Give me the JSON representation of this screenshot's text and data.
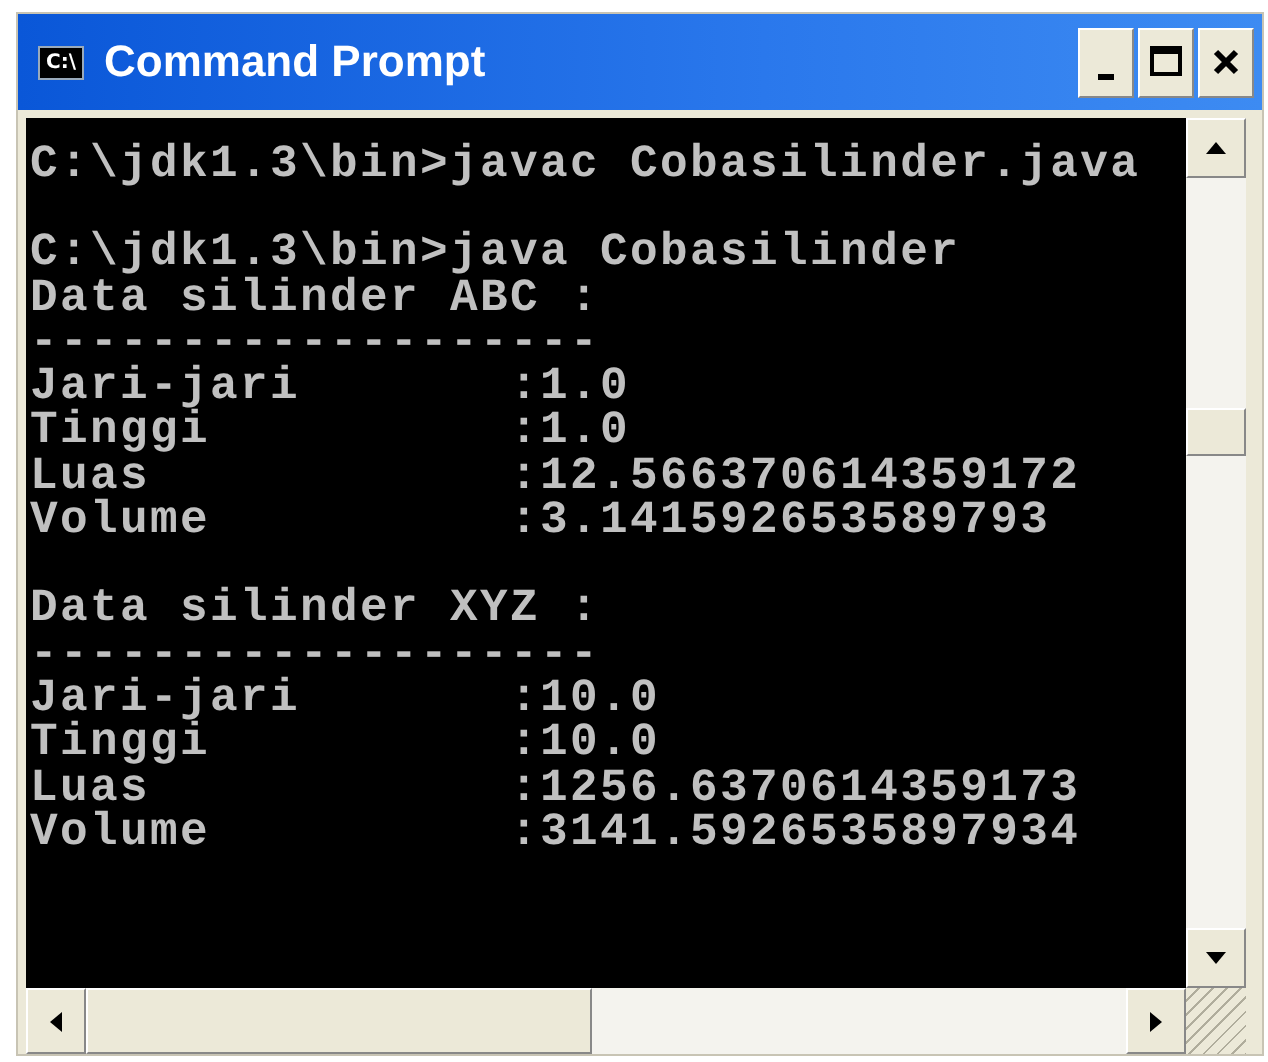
{
  "window": {
    "title": "Command Prompt",
    "icon_text": "C:\\"
  },
  "console": {
    "blocks": [
      [
        "C:\\jdk1.3\\bin>javac Cobasilinder.java"
      ],
      [
        "C:\\jdk1.3\\bin>java Cobasilinder",
        "Data silinder ABC :",
        "-------------------",
        "Jari-jari       :1.0",
        "Tinggi          :1.0",
        "Luas            :12.566370614359172",
        "Volume          :3.141592653589793"
      ],
      [
        "Data silinder XYZ :",
        "-------------------",
        "Jari-jari       :10.0",
        "Tinggi          :10.0",
        "Luas            :1256.6370614359173",
        "Volume          :3141.5926535897934"
      ]
    ]
  }
}
